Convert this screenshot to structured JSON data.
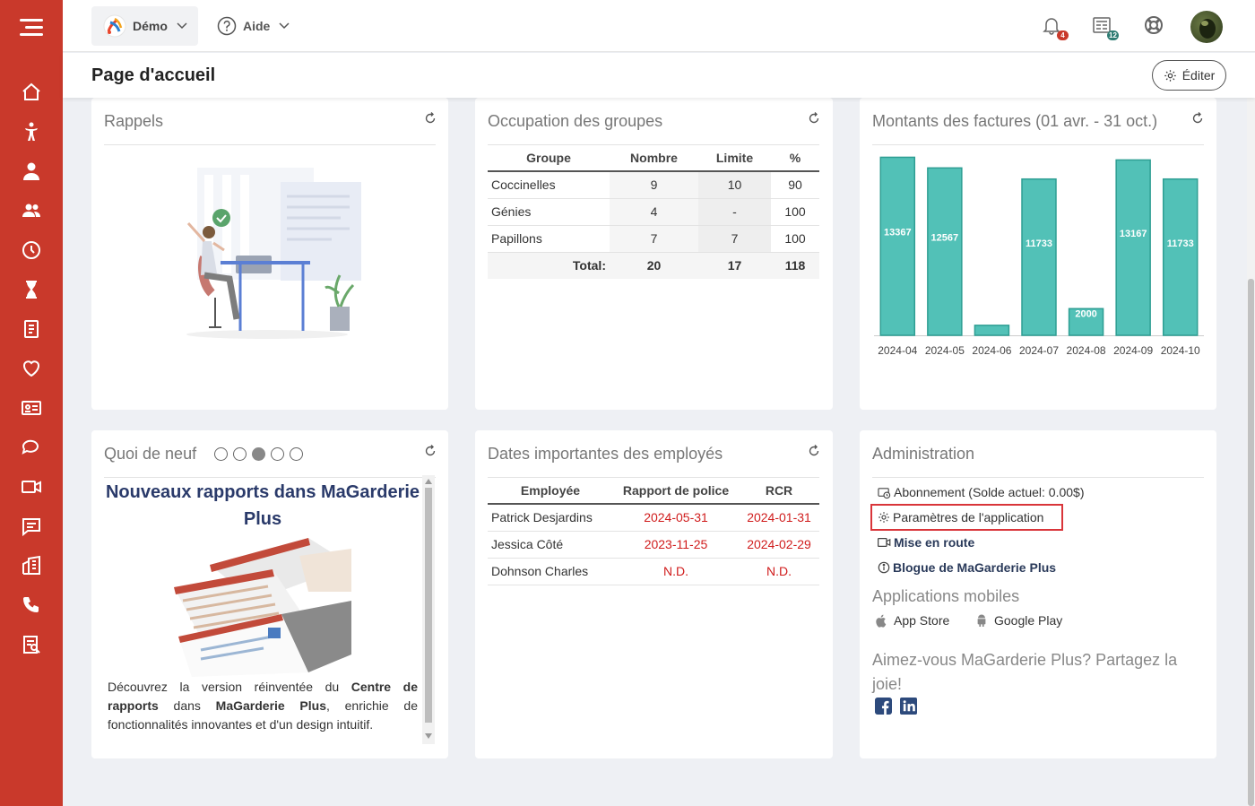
{
  "topbar": {
    "demo_label": "Démo",
    "help_label": "Aide",
    "notifications_count": "4",
    "news_count": "12"
  },
  "header": {
    "title": "Page d'accueil",
    "edit_label": "Éditer"
  },
  "reminders": {
    "title": "Rappels"
  },
  "groups": {
    "title": "Occupation des groupes",
    "columns": [
      "Groupe",
      "Nombre",
      "Limite",
      "%"
    ],
    "rows": [
      {
        "name": "Coccinelles",
        "count": "9",
        "limit": "10",
        "pct": "90"
      },
      {
        "name": "Génies",
        "count": "4",
        "limit": "-",
        "pct": "100"
      },
      {
        "name": "Papillons",
        "count": "7",
        "limit": "7",
        "pct": "100"
      }
    ],
    "total": {
      "label": "Total:",
      "count": "20",
      "limit": "17",
      "pct": "118"
    }
  },
  "invoices": {
    "title": "Montants des factures (01 avr. - 31 oct.)"
  },
  "chart_data": {
    "type": "bar",
    "title": "Montants des factures (01 avr. - 31 oct.)",
    "categories": [
      "2024-04",
      "2024-05",
      "2024-06",
      "2024-07",
      "2024-08",
      "2024-09",
      "2024-10"
    ],
    "values": [
      13367,
      12567,
      750,
      11733,
      2000,
      13167,
      11733
    ],
    "labels": [
      "13367",
      "12567",
      "",
      "11733",
      "2000",
      "13167",
      "11733"
    ],
    "ylim": [
      0,
      13800
    ],
    "bar_color": "#52c1b7",
    "grid": false
  },
  "news": {
    "title": "Quoi de neuf",
    "slide_count": 5,
    "active_slide": 3,
    "headline": "Nouveaux rapports dans MaGarderie Plus",
    "body_1": "Découvrez la version réinventée du ",
    "body_bold_1": "Centre de rapports",
    "body_2": " dans ",
    "body_bold_2": "MaGarderie Plus",
    "body_3": ", enrichie de fonctionnalités innovantes et d'un design intuitif."
  },
  "employees": {
    "title": "Dates importantes des employés",
    "columns": [
      "Employée",
      "Rapport de police",
      "RCR"
    ],
    "rows": [
      {
        "name": "Patrick Desjardins",
        "police": "2024-05-31",
        "rcr": "2024-01-31"
      },
      {
        "name": "Jessica Côté",
        "police": "2023-11-25",
        "rcr": "2024-02-29"
      },
      {
        "name": "Dohnson Charles",
        "police": "N.D.",
        "rcr": "N.D."
      }
    ]
  },
  "admin": {
    "title": "Administration",
    "subscription": "Abonnement (Solde actuel: 0.00$)",
    "settings": "Paramètres de l'application",
    "setup": "Mise en route",
    "blog": "Blogue de MaGarderie Plus",
    "mobile_title": "Applications mobiles",
    "app_store": "App Store",
    "google_play": "Google Play",
    "share_text": "Aimez-vous MaGarderie Plus? Partagez la joie!"
  },
  "colors": {
    "sidebar": "#c9392b",
    "accent_teal": "#52c1b7",
    "alert_red": "#d01c1c",
    "highlight_border": "#d9353a"
  }
}
